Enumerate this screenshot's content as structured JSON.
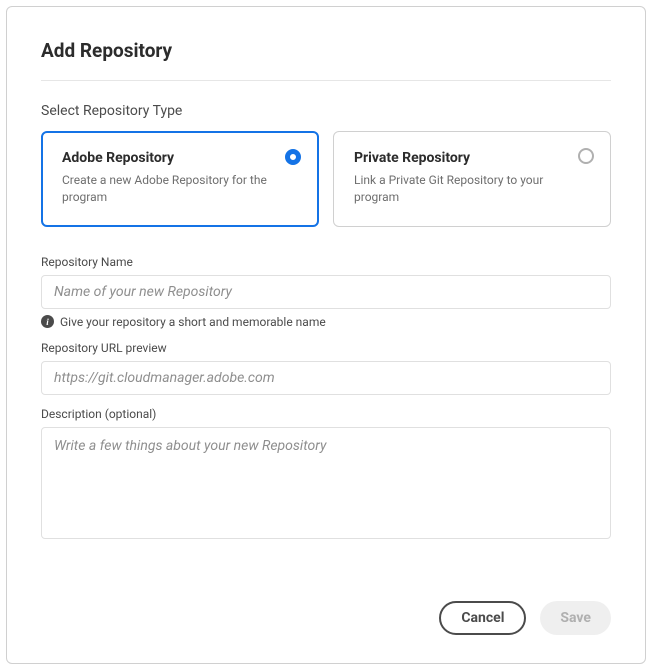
{
  "title": "Add Repository",
  "section_label": "Select Repository Type",
  "types": {
    "adobe": {
      "title": "Adobe Repository",
      "desc": "Create a new Adobe Repository for the program"
    },
    "private": {
      "title": "Private Repository",
      "desc": "Link a Private Git Repository to your program"
    }
  },
  "fields": {
    "name": {
      "label": "Repository Name",
      "placeholder": "Name of your new Repository",
      "helper": "Give your repository a short and memorable name"
    },
    "url": {
      "label": "Repository URL preview",
      "placeholder": "https://git.cloudmanager.adobe.com"
    },
    "desc": {
      "label": "Description (optional)",
      "placeholder": "Write a few things about your new Repository"
    }
  },
  "buttons": {
    "cancel": "Cancel",
    "save": "Save"
  }
}
